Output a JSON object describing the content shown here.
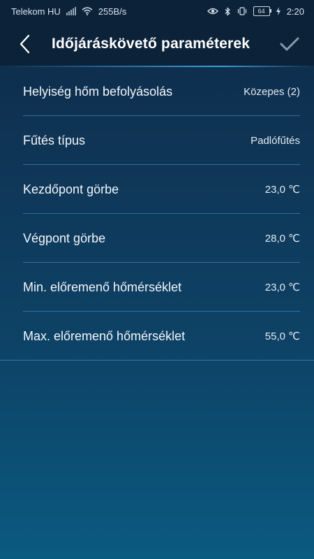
{
  "status_bar": {
    "carrier": "Telekom HU",
    "speed": "255B/s",
    "battery": "64",
    "time": "2:20"
  },
  "header": {
    "title": "Időjáráskövető paraméterek",
    "back_icon": "chevron-left-icon",
    "confirm_icon": "checkmark-icon"
  },
  "settings": [
    {
      "label": "Helyiség hőm befolyásolás",
      "value": "Közepes (2)"
    },
    {
      "label": "Fűtés típus",
      "value": "Padlófűtés"
    },
    {
      "label": "Kezdőpont görbe",
      "value": "23,0 ℃"
    },
    {
      "label": "Végpont görbe",
      "value": "28,0 ℃"
    },
    {
      "label": "Min. előremenő hőmérséklet",
      "value": "23,0 ℃"
    },
    {
      "label": "Max. előremenő hőmérséklet",
      "value": "55,0 ℃"
    }
  ],
  "colors": {
    "header_bg": "#0b2238",
    "accent_line": "#46aaeb",
    "background_bottom": "#0b5a80"
  }
}
